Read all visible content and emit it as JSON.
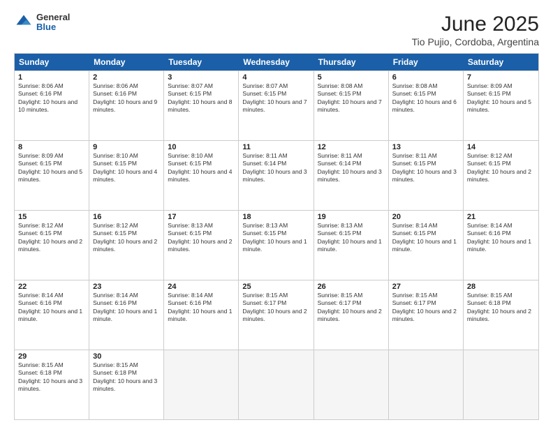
{
  "header": {
    "logo_general": "General",
    "logo_blue": "Blue",
    "title": "June 2025",
    "subtitle": "Tio Pujio, Cordoba, Argentina"
  },
  "days": [
    "Sunday",
    "Monday",
    "Tuesday",
    "Wednesday",
    "Thursday",
    "Friday",
    "Saturday"
  ],
  "weeks": [
    [
      {
        "day": "1",
        "sunrise": "8:06 AM",
        "sunset": "6:16 PM",
        "daylight": "10 hours and 10 minutes."
      },
      {
        "day": "2",
        "sunrise": "8:06 AM",
        "sunset": "6:16 PM",
        "daylight": "10 hours and 9 minutes."
      },
      {
        "day": "3",
        "sunrise": "8:07 AM",
        "sunset": "6:15 PM",
        "daylight": "10 hours and 8 minutes."
      },
      {
        "day": "4",
        "sunrise": "8:07 AM",
        "sunset": "6:15 PM",
        "daylight": "10 hours and 7 minutes."
      },
      {
        "day": "5",
        "sunrise": "8:08 AM",
        "sunset": "6:15 PM",
        "daylight": "10 hours and 7 minutes."
      },
      {
        "day": "6",
        "sunrise": "8:08 AM",
        "sunset": "6:15 PM",
        "daylight": "10 hours and 6 minutes."
      },
      {
        "day": "7",
        "sunrise": "8:09 AM",
        "sunset": "6:15 PM",
        "daylight": "10 hours and 5 minutes."
      }
    ],
    [
      {
        "day": "8",
        "sunrise": "8:09 AM",
        "sunset": "6:15 PM",
        "daylight": "10 hours and 5 minutes."
      },
      {
        "day": "9",
        "sunrise": "8:10 AM",
        "sunset": "6:15 PM",
        "daylight": "10 hours and 4 minutes."
      },
      {
        "day": "10",
        "sunrise": "8:10 AM",
        "sunset": "6:15 PM",
        "daylight": "10 hours and 4 minutes."
      },
      {
        "day": "11",
        "sunrise": "8:11 AM",
        "sunset": "6:14 PM",
        "daylight": "10 hours and 3 minutes."
      },
      {
        "day": "12",
        "sunrise": "8:11 AM",
        "sunset": "6:14 PM",
        "daylight": "10 hours and 3 minutes."
      },
      {
        "day": "13",
        "sunrise": "8:11 AM",
        "sunset": "6:15 PM",
        "daylight": "10 hours and 3 minutes."
      },
      {
        "day": "14",
        "sunrise": "8:12 AM",
        "sunset": "6:15 PM",
        "daylight": "10 hours and 2 minutes."
      }
    ],
    [
      {
        "day": "15",
        "sunrise": "8:12 AM",
        "sunset": "6:15 PM",
        "daylight": "10 hours and 2 minutes."
      },
      {
        "day": "16",
        "sunrise": "8:12 AM",
        "sunset": "6:15 PM",
        "daylight": "10 hours and 2 minutes."
      },
      {
        "day": "17",
        "sunrise": "8:13 AM",
        "sunset": "6:15 PM",
        "daylight": "10 hours and 2 minutes."
      },
      {
        "day": "18",
        "sunrise": "8:13 AM",
        "sunset": "6:15 PM",
        "daylight": "10 hours and 1 minute."
      },
      {
        "day": "19",
        "sunrise": "8:13 AM",
        "sunset": "6:15 PM",
        "daylight": "10 hours and 1 minute."
      },
      {
        "day": "20",
        "sunrise": "8:14 AM",
        "sunset": "6:15 PM",
        "daylight": "10 hours and 1 minute."
      },
      {
        "day": "21",
        "sunrise": "8:14 AM",
        "sunset": "6:16 PM",
        "daylight": "10 hours and 1 minute."
      }
    ],
    [
      {
        "day": "22",
        "sunrise": "8:14 AM",
        "sunset": "6:16 PM",
        "daylight": "10 hours and 1 minute."
      },
      {
        "day": "23",
        "sunrise": "8:14 AM",
        "sunset": "6:16 PM",
        "daylight": "10 hours and 1 minute."
      },
      {
        "day": "24",
        "sunrise": "8:14 AM",
        "sunset": "6:16 PM",
        "daylight": "10 hours and 1 minute."
      },
      {
        "day": "25",
        "sunrise": "8:15 AM",
        "sunset": "6:17 PM",
        "daylight": "10 hours and 2 minutes."
      },
      {
        "day": "26",
        "sunrise": "8:15 AM",
        "sunset": "6:17 PM",
        "daylight": "10 hours and 2 minutes."
      },
      {
        "day": "27",
        "sunrise": "8:15 AM",
        "sunset": "6:17 PM",
        "daylight": "10 hours and 2 minutes."
      },
      {
        "day": "28",
        "sunrise": "8:15 AM",
        "sunset": "6:18 PM",
        "daylight": "10 hours and 2 minutes."
      }
    ],
    [
      {
        "day": "29",
        "sunrise": "8:15 AM",
        "sunset": "6:18 PM",
        "daylight": "10 hours and 3 minutes."
      },
      {
        "day": "30",
        "sunrise": "8:15 AM",
        "sunset": "6:18 PM",
        "daylight": "10 hours and 3 minutes."
      },
      null,
      null,
      null,
      null,
      null
    ]
  ]
}
